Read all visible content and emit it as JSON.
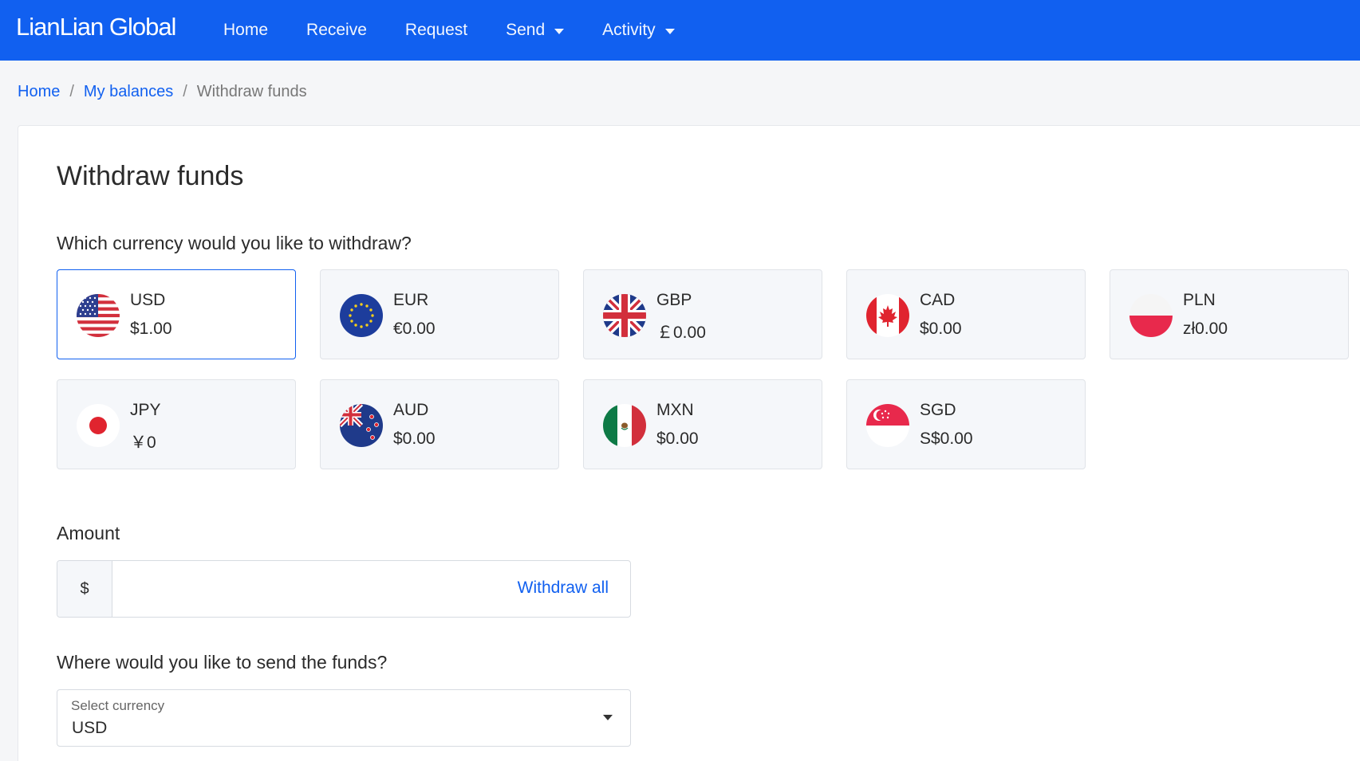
{
  "brand": {
    "logo_text": "LianLian Global"
  },
  "nav": {
    "items": [
      {
        "label": "Home",
        "dropdown": false
      },
      {
        "label": "Receive",
        "dropdown": false
      },
      {
        "label": "Request",
        "dropdown": false
      },
      {
        "label": "Send",
        "dropdown": true
      },
      {
        "label": "Activity",
        "dropdown": true
      }
    ]
  },
  "breadcrumb": {
    "home": "Home",
    "balances": "My balances",
    "current": "Withdraw funds",
    "separator": "/"
  },
  "page": {
    "title": "Withdraw funds",
    "currency_question": "Which currency would you like to withdraw?",
    "amount_label": "Amount",
    "destination_question": "Where would you like to send the funds?"
  },
  "currencies": [
    {
      "code": "USD",
      "balance": "$1.00",
      "flag": "us-flag-icon",
      "selected": true
    },
    {
      "code": "EUR",
      "balance": "€0.00",
      "flag": "eu-flag-icon",
      "selected": false
    },
    {
      "code": "GBP",
      "balance": "￡0.00",
      "flag": "uk-flag-icon",
      "selected": false
    },
    {
      "code": "CAD",
      "balance": "$0.00",
      "flag": "canada-flag-icon",
      "selected": false
    },
    {
      "code": "PLN",
      "balance": "zł0.00",
      "flag": "poland-flag-icon",
      "selected": false
    },
    {
      "code": "JPY",
      "balance": "￥0",
      "flag": "japan-flag-icon",
      "selected": false
    },
    {
      "code": "AUD",
      "balance": "$0.00",
      "flag": "australia-flag-icon",
      "selected": false
    },
    {
      "code": "MXN",
      "balance": "$0.00",
      "flag": "mexico-flag-icon",
      "selected": false
    },
    {
      "code": "SGD",
      "balance": "S$0.00",
      "flag": "singapore-flag-icon",
      "selected": false
    }
  ],
  "amount": {
    "prefix": "$",
    "value": "",
    "withdraw_all": "Withdraw all"
  },
  "destination": {
    "label": "Select currency",
    "value": "USD"
  },
  "colors": {
    "brand_blue": "#1160f0",
    "page_bg": "#f5f6f8",
    "card_bg": "#f5f7fa"
  }
}
